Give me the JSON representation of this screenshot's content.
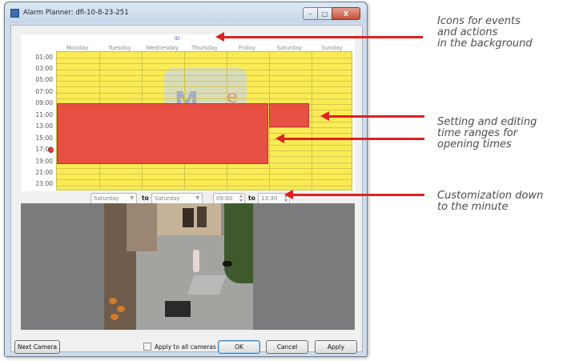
{
  "window": {
    "title": "Alarm Planner: dfi-10-8-23-251",
    "minimize_glyph": "–",
    "maximize_glyph": "□",
    "close_glyph": "X"
  },
  "scheduler": {
    "bg_icon_label": "ID",
    "days": [
      "Monday",
      "Tuesday",
      "Wednesday",
      "Thursday",
      "Friday",
      "Saturday",
      "Sunday"
    ],
    "times": [
      "01:00",
      "03:00",
      "05:00",
      "07:00",
      "09:00",
      "11:00",
      "13:00",
      "15:00",
      "17:00",
      "19:00",
      "21:00",
      "23:00"
    ],
    "colors": {
      "background": "#fbeb55",
      "time_range": "#e84f43"
    }
  },
  "range_editor": {
    "from_day": "Saturday",
    "to_label": "to",
    "to_day": "Saturday",
    "from_time": "09:00",
    "to_label2": "to",
    "to_time": "13:30"
  },
  "footer": {
    "next_camera": "Next Camera",
    "apply_all_label": "Apply to all cameras",
    "ok": "OK",
    "cancel": "Cancel",
    "apply": "Apply"
  },
  "annotations": {
    "icons": [
      "Icons for events",
      "and actions",
      "in the background"
    ],
    "editing": [
      "Setting and editing",
      "time ranges for",
      "opening times"
    ],
    "minute": [
      "Customization down",
      "to the minute"
    ]
  },
  "icons": {
    "window_icon": "app-icon",
    "dropdown": "chevron-down-icon",
    "spinner": "spinner-icon",
    "alarm_marker": "alarm-dot-icon"
  }
}
